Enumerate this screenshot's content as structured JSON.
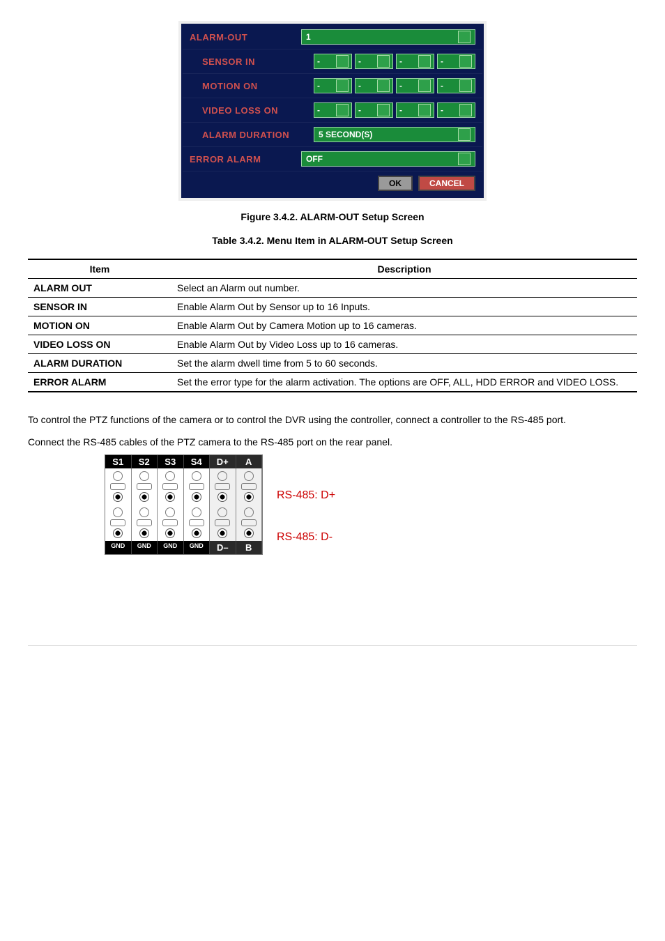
{
  "setup": {
    "alarm_out_label": "ALARM-OUT",
    "alarm_out_value": "1",
    "sensor_in_label": "SENSOR IN",
    "sensor_in_values": [
      "-",
      "-",
      "-",
      "-"
    ],
    "motion_on_label": "MOTION ON",
    "motion_on_values": [
      "-",
      "-",
      "-",
      "-"
    ],
    "video_loss_on_label": "VIDEO LOSS ON",
    "video_loss_on_values": [
      "-",
      "-",
      "-",
      "-"
    ],
    "alarm_duration_label": "ALARM DURATION",
    "alarm_duration_value": "5 SECOND(S)",
    "error_alarm_label": "ERROR ALARM",
    "error_alarm_value": "OFF",
    "ok": "OK",
    "cancel": "CANCEL"
  },
  "figure_caption": "Figure 3.4.2. ALARM-OUT Setup Screen",
  "table_caption": "Table 3.4.2. Menu Item in ALARM-OUT Setup Screen",
  "table": {
    "headers": [
      "Item",
      "Description"
    ],
    "rows": [
      {
        "item": "ALARM OUT",
        "desc": "Select an Alarm out number."
      },
      {
        "item": "SENSOR IN",
        "desc": "Enable Alarm Out by Sensor up to 16 Inputs."
      },
      {
        "item": "MOTION ON",
        "desc": "Enable Alarm Out by Camera Motion up to 16 cameras."
      },
      {
        "item": "VIDEO LOSS ON",
        "desc": "Enable Alarm Out by Video Loss up to 16 cameras."
      },
      {
        "item": "ALARM DURATION",
        "desc": "Set the alarm dwell time from 5 to 60 seconds."
      },
      {
        "item": "ERROR ALARM",
        "desc": "Set the error type for the alarm activation. The options are OFF, ALL, HDD ERROR and VIDEO LOSS."
      }
    ]
  },
  "body_text_1": "To control the PTZ functions of the camera or to control the DVR using the controller, connect a controller to the RS-485 port.",
  "body_text_2": "Connect the RS-485 cables of the PTZ camera to the RS-485 port on the rear panel.",
  "terminal": {
    "top": [
      "S1",
      "S2",
      "S3",
      "S4",
      "D+",
      "A"
    ],
    "bottom_gnd": "GND",
    "bottom": [
      "G\nN\nD",
      "G\nN\nD",
      "G\nN\nD",
      "G\nN\nD",
      "D–",
      "B"
    ]
  },
  "rs485_pos": "RS-485: D+",
  "rs485_neg": "RS-485: D-"
}
